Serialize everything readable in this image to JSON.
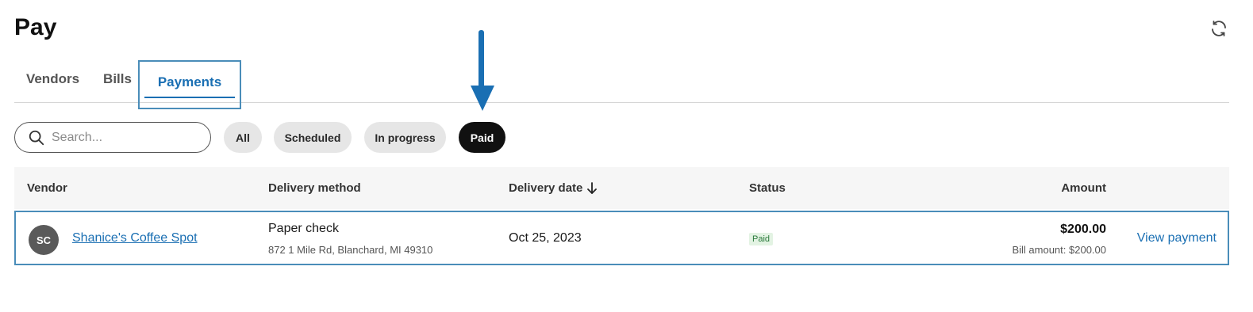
{
  "page": {
    "title": "Pay"
  },
  "tabs": [
    {
      "label": "Vendors"
    },
    {
      "label": "Bills"
    },
    {
      "label": "Payments",
      "active": true
    }
  ],
  "search": {
    "placeholder": "Search..."
  },
  "filters": [
    {
      "label": "All"
    },
    {
      "label": "Scheduled"
    },
    {
      "label": "In progress"
    },
    {
      "label": "Paid",
      "selected": true
    }
  ],
  "table": {
    "headers": {
      "vendor": "Vendor",
      "delivery_method": "Delivery method",
      "delivery_date": "Delivery date",
      "status": "Status",
      "amount": "Amount"
    },
    "rows": [
      {
        "avatar": "SC",
        "vendor": "Shanice's Coffee Spot",
        "method": "Paper check",
        "address": "872 1 Mile Rd, Blanchard, MI 49310",
        "date": "Oct 25, 2023",
        "status": "Paid",
        "amount": "$200.00",
        "bill_amount": "Bill amount: $200.00",
        "action": "View payment"
      }
    ]
  },
  "icons": {
    "refresh": "refresh-icon",
    "search": "search-icon",
    "sort": "arrow-down-icon",
    "annotation": "arrow-down-icon"
  },
  "colors": {
    "accent": "#1a6fb3",
    "highlight_border": "#4a8db9",
    "chip_selected": "#111111",
    "chip_default": "#e6e6e6",
    "status_paid_text": "#2b7a3c",
    "status_paid_bg": "#e3f3e3"
  }
}
